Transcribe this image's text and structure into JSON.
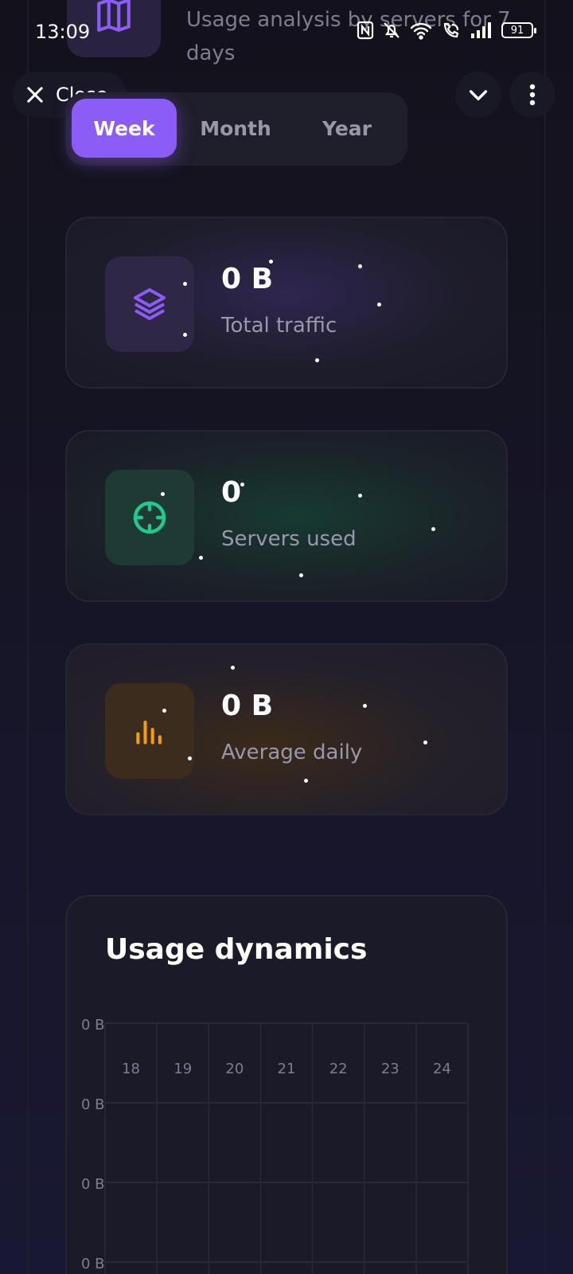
{
  "status_bar": {
    "time": "13:09",
    "battery": "91"
  },
  "header": {
    "subtitle": "Usage analysis by servers for 7 days"
  },
  "webview": {
    "close_label": "Close"
  },
  "period_tabs": {
    "items": [
      "Week",
      "Month",
      "Year"
    ],
    "active": "Week"
  },
  "stats": {
    "total_traffic": {
      "value": "0 B",
      "label": "Total traffic"
    },
    "servers_used": {
      "value": "0",
      "label": "Servers used"
    },
    "average_daily": {
      "value": "0 B",
      "label": "Average daily"
    }
  },
  "colors": {
    "accent": "#8b5cf6",
    "green": "#22c98f",
    "orange": "#f59e0b"
  },
  "chart_data": {
    "type": "bar",
    "title": "Usage dynamics",
    "categories": [
      "18",
      "19",
      "20",
      "21",
      "22",
      "23",
      "24"
    ],
    "values": [
      0,
      0,
      0,
      0,
      0,
      0,
      0
    ],
    "y_tick_labels": [
      "0 B",
      "0 B",
      "0 B",
      "0 B"
    ],
    "grid": true
  }
}
